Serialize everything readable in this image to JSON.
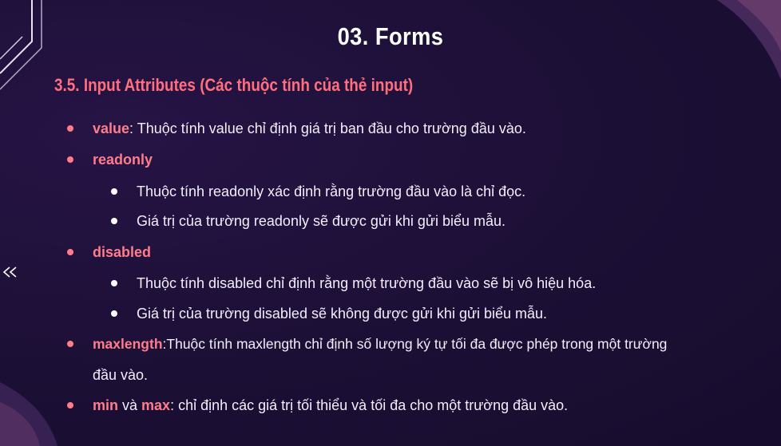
{
  "slide": {
    "title": "03. Forms",
    "section_heading": "3.5. Input Attributes (Các thuộc tính của thẻ input)",
    "items": {
      "value": {
        "keyword": "value",
        "text": ": Thuộc tính value chỉ định giá trị ban đầu cho trường đầu vào."
      },
      "readonly": {
        "keyword": "readonly",
        "sub": [
          "Thuộc tính readonly xác định rằng trường đầu vào là chỉ đọc.",
          "Giá trị của trường readonly sẽ được gửi khi gửi biểu mẫu."
        ]
      },
      "disabled": {
        "keyword": "disabled",
        "sub": [
          "Thuộc tính disabled chỉ định rằng một trường đầu vào sẽ bị vô hiệu hóa.",
          "Giá trị của trường disabled sẽ không được gửi khi gửi biểu mẫu."
        ]
      },
      "maxlength": {
        "keyword": "maxlength",
        "text": ":Thuộc tính maxlength chỉ định số lượng ký tự tối đa được phép trong một trường",
        "text_cont": "đầu vào."
      },
      "minmax": {
        "keyword_min": "min",
        "joiner": " và ",
        "keyword_max": "max",
        "text": ": chỉ định các giá trị tối thiểu và tối đa cho một trường đầu vào."
      }
    }
  },
  "colors": {
    "background": "#1c0f35",
    "accent": "#ff7d8a",
    "text": "#f3eefc"
  },
  "icons": {
    "prev": "double-chevron-left-icon"
  }
}
